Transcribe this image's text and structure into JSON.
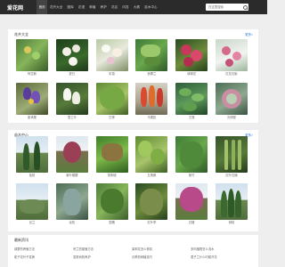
{
  "site": {
    "logo": "爱花网",
    "nav": [
      {
        "label": "首页",
        "active": true
      },
      {
        "label": "花卉大全",
        "active": false
      },
      {
        "label": "图库",
        "active": false
      },
      {
        "label": "花语",
        "active": false
      },
      {
        "label": "种植",
        "active": false
      },
      {
        "label": "养护",
        "active": false
      },
      {
        "label": "花店",
        "active": false
      },
      {
        "label": "问答",
        "active": false
      },
      {
        "label": "大赛",
        "active": false
      },
      {
        "label": "苗木中心",
        "active": false
      },
      {
        "label": "花木大全",
        "active": false
      }
    ],
    "search_placeholder": "在这里搜索",
    "search_icon": "search-icon"
  },
  "flowers": {
    "title": "花卉大全",
    "more": "更多>",
    "items": [
      {
        "label": "阿拉斯"
      },
      {
        "label": "夏日"
      },
      {
        "label": "彩霞"
      },
      {
        "label": "翡翠兰"
      },
      {
        "label": "绣球花"
      },
      {
        "label": "红花石斛"
      },
      {
        "label": "紫鸢尾"
      },
      {
        "label": "雪之华"
      },
      {
        "label": "白桦"
      },
      {
        "label": "马尾松"
      },
      {
        "label": "王莲"
      },
      {
        "label": "光明堂"
      }
    ]
  },
  "seedlings": {
    "title": "苗木中心",
    "more": "更多>",
    "items": [
      {
        "label": "桧柏"
      },
      {
        "label": "紫叶矮樱"
      },
      {
        "label": "茶条槭"
      },
      {
        "label": "五角枫"
      },
      {
        "label": "紫竹"
      },
      {
        "label": "红叶石楠"
      },
      {
        "label": "丝兰"
      },
      {
        "label": "龙柏"
      },
      {
        "label": "国槐"
      },
      {
        "label": "红叶李"
      },
      {
        "label": "白蜡"
      },
      {
        "label": "侧柏"
      }
    ]
  },
  "articles": {
    "title": "最新资讯",
    "items": [
      {
        "label": "绿萝的养殖方法"
      },
      {
        "label": "吊兰的繁殖方法"
      },
      {
        "label": "茉莉花怎么修剪"
      },
      {
        "label": "多肉植物怎么浇水"
      },
      {
        "label": "栀子花叶子发黄"
      },
      {
        "label": "发财树的养护"
      },
      {
        "label": "月季的种植技巧"
      },
      {
        "label": "君子兰什么时候开花"
      }
    ]
  }
}
